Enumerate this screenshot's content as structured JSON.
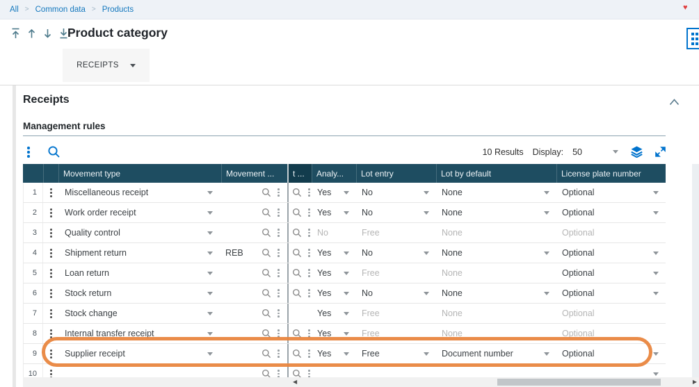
{
  "breadcrumb": {
    "separator": ">",
    "items": [
      "All",
      "Common data",
      "Products"
    ]
  },
  "title_bar": {
    "title": "Product category"
  },
  "actions": {
    "receipts_button_label": "RECEIPTS"
  },
  "section": {
    "title": "Receipts"
  },
  "subsection": {
    "title": "Management rules"
  },
  "toolbar": {
    "results_text": "10 Results",
    "display_label": "Display:",
    "display_value": "50"
  },
  "colors": {
    "accent_blue": "#0073cd",
    "header_bg": "#1e4d61",
    "header_dark_bg": "#123c4d",
    "annotation_orange": "#e8833b"
  },
  "table": {
    "columns": [
      {
        "key": "num",
        "label": ""
      },
      {
        "key": "drag",
        "label": ""
      },
      {
        "key": "movement_type",
        "label": "Movement type"
      },
      {
        "key": "movement_code",
        "label": "Movement ..."
      },
      {
        "key": "t",
        "label": "t ..."
      },
      {
        "key": "analy",
        "label": "Analy..."
      },
      {
        "key": "lot_entry",
        "label": "Lot entry"
      },
      {
        "key": "lot_default",
        "label": "Lot by default"
      },
      {
        "key": "license_plate",
        "label": "License plate number"
      }
    ],
    "rows": [
      {
        "num": "1",
        "movement_type": "Miscellaneous receipt",
        "movement_type_editable": true,
        "movement_code": "",
        "has_code_lookup": true,
        "has_t_lookup": true,
        "analy": {
          "value": "Yes",
          "editable": true
        },
        "lot_entry": {
          "value": "No",
          "editable": true
        },
        "lot_default": {
          "value": "None",
          "editable": true
        },
        "license_plate": {
          "value": "Optional",
          "editable": true
        },
        "highlighted": false
      },
      {
        "num": "2",
        "movement_type": "Work order receipt",
        "movement_type_editable": true,
        "movement_code": "",
        "has_code_lookup": true,
        "has_t_lookup": true,
        "analy": {
          "value": "Yes",
          "editable": true
        },
        "lot_entry": {
          "value": "No",
          "editable": true
        },
        "lot_default": {
          "value": "None",
          "editable": true
        },
        "license_plate": {
          "value": "Optional",
          "editable": true
        },
        "highlighted": false
      },
      {
        "num": "3",
        "movement_type": "Quality control",
        "movement_type_editable": true,
        "movement_code": "",
        "has_code_lookup": true,
        "has_t_lookup": true,
        "analy": {
          "value": "No",
          "editable": false
        },
        "lot_entry": {
          "value": "Free",
          "editable": false
        },
        "lot_default": {
          "value": "None",
          "editable": false
        },
        "license_plate": {
          "value": "Optional",
          "editable": false
        },
        "highlighted": false
      },
      {
        "num": "4",
        "movement_type": "Shipment return",
        "movement_type_editable": true,
        "movement_code": "REB",
        "has_code_lookup": true,
        "has_t_lookup": true,
        "analy": {
          "value": "Yes",
          "editable": true
        },
        "lot_entry": {
          "value": "No",
          "editable": true
        },
        "lot_default": {
          "value": "None",
          "editable": true
        },
        "license_plate": {
          "value": "Optional",
          "editable": true
        },
        "highlighted": false
      },
      {
        "num": "5",
        "movement_type": "Loan return",
        "movement_type_editable": true,
        "movement_code": "",
        "has_code_lookup": true,
        "has_t_lookup": true,
        "analy": {
          "value": "Yes",
          "editable": true
        },
        "lot_entry": {
          "value": "Free",
          "editable": false
        },
        "lot_default": {
          "value": "None",
          "editable": false
        },
        "license_plate": {
          "value": "Optional",
          "editable": true
        },
        "highlighted": false
      },
      {
        "num": "6",
        "movement_type": "Stock return",
        "movement_type_editable": true,
        "movement_code": "",
        "has_code_lookup": true,
        "has_t_lookup": true,
        "analy": {
          "value": "Yes",
          "editable": true
        },
        "lot_entry": {
          "value": "No",
          "editable": true
        },
        "lot_default": {
          "value": "None",
          "editable": true
        },
        "license_plate": {
          "value": "Optional",
          "editable": true
        },
        "highlighted": false
      },
      {
        "num": "7",
        "movement_type": "Stock change",
        "movement_type_editable": true,
        "movement_code": "",
        "has_code_lookup": true,
        "has_t_lookup": false,
        "analy": {
          "value": "Yes",
          "editable": true
        },
        "lot_entry": {
          "value": "Free",
          "editable": false
        },
        "lot_default": {
          "value": "None",
          "editable": false
        },
        "license_plate": {
          "value": "Optional",
          "editable": false
        },
        "highlighted": false
      },
      {
        "num": "8",
        "movement_type": "Internal transfer receipt",
        "movement_type_editable": true,
        "movement_code": "",
        "has_code_lookup": true,
        "has_t_lookup": true,
        "analy": {
          "value": "Yes",
          "editable": true
        },
        "lot_entry": {
          "value": "Free",
          "editable": false
        },
        "lot_default": {
          "value": "None",
          "editable": false
        },
        "license_plate": {
          "value": "Optional",
          "editable": false
        },
        "highlighted": false
      },
      {
        "num": "9",
        "movement_type": "Supplier receipt",
        "movement_type_editable": true,
        "movement_code": "",
        "has_code_lookup": true,
        "has_t_lookup": true,
        "analy": {
          "value": "Yes",
          "editable": true
        },
        "lot_entry": {
          "value": "Free",
          "editable": true
        },
        "lot_default": {
          "value": "Document number",
          "editable": true
        },
        "license_plate": {
          "value": "Optional",
          "editable": true
        },
        "highlighted": true
      },
      {
        "num": "10",
        "movement_type": "",
        "movement_type_editable": false,
        "movement_code": "",
        "has_code_lookup": true,
        "has_t_lookup": true,
        "analy": {
          "value": "",
          "editable": false
        },
        "lot_entry": {
          "value": "",
          "editable": false
        },
        "lot_default": {
          "value": "",
          "editable": false
        },
        "license_plate": {
          "value": "",
          "editable": true
        },
        "highlighted": false
      }
    ]
  }
}
